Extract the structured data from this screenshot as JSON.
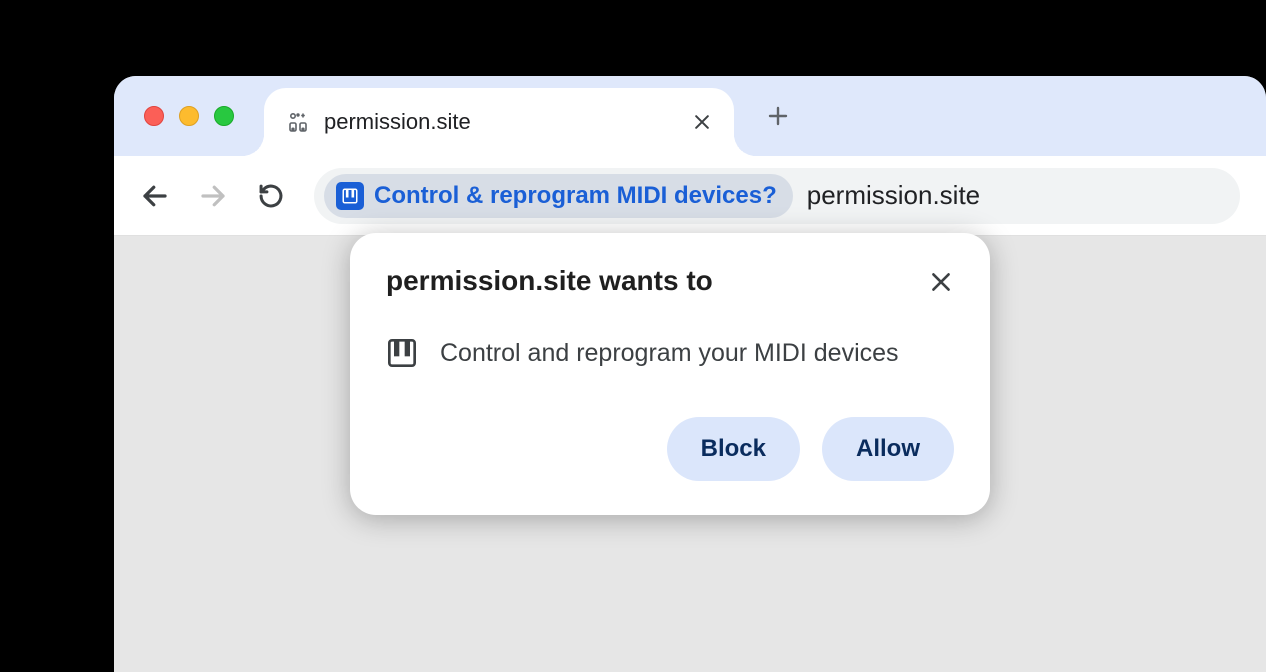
{
  "tab": {
    "title": "permission.site"
  },
  "omnibox": {
    "chip_label": "Control & reprogram MIDI devices?",
    "url": "permission.site"
  },
  "prompt": {
    "title": "permission.site wants to",
    "body": "Control and reprogram your MIDI devices",
    "block_label": "Block",
    "allow_label": "Allow"
  }
}
